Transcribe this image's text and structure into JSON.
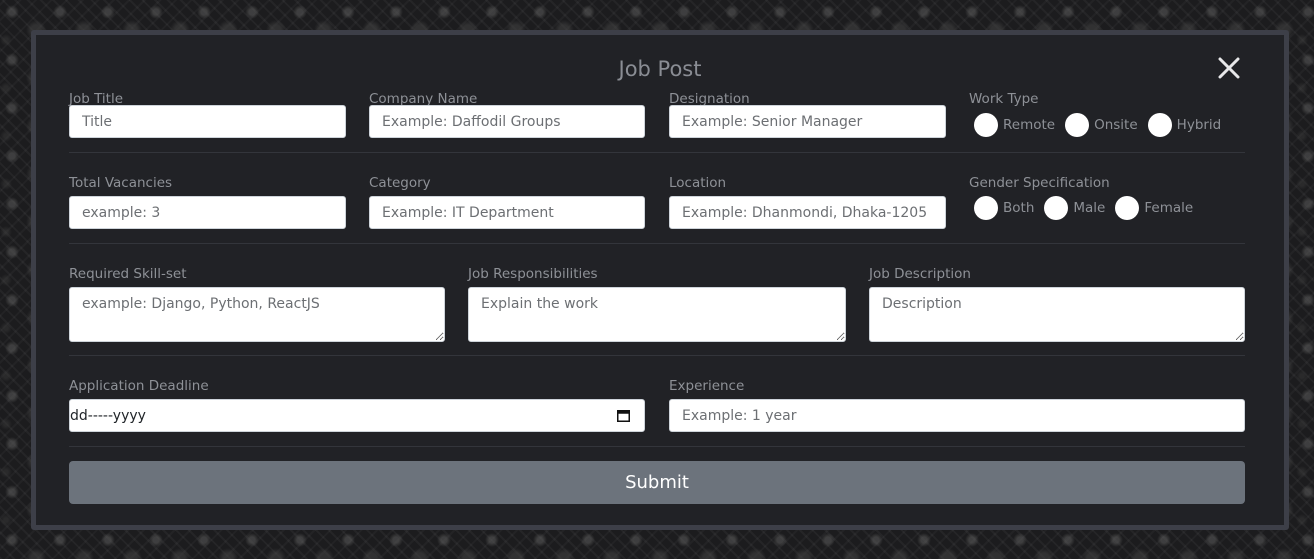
{
  "modal": {
    "title": "Job Post"
  },
  "row1": {
    "job_title": {
      "label": "Job Title",
      "placeholder": "Title"
    },
    "company_name": {
      "label": "Company Name",
      "placeholder": "Example: Daffodil Groups"
    },
    "designation": {
      "label": "Designation",
      "placeholder": "Example: Senior Manager"
    },
    "work_type": {
      "label": "Work Type",
      "options": [
        "Remote",
        "Onsite",
        "Hybrid"
      ]
    }
  },
  "row2": {
    "total_vacancies": {
      "label": "Total Vacancies",
      "placeholder": "example: 3"
    },
    "category": {
      "label": "Category",
      "placeholder": "Example: IT Department"
    },
    "location": {
      "label": "Location",
      "placeholder": "Example: Dhanmondi, Dhaka-1205"
    },
    "gender": {
      "label": "Gender Specification",
      "options": [
        "Both",
        "Male",
        "Female"
      ]
    }
  },
  "row3": {
    "skills": {
      "label": "Required Skill-set",
      "placeholder": "example: Django, Python, ReactJS"
    },
    "responsibilities": {
      "label": "Job Responsibilities",
      "placeholder": "Explain the work"
    },
    "description": {
      "label": "Job Description",
      "placeholder": "Description"
    }
  },
  "row4": {
    "deadline": {
      "label": "Application Deadline",
      "value": "dd-----yyyy"
    },
    "experience": {
      "label": "Experience",
      "placeholder": "Example: 1 year"
    }
  },
  "submit_label": "Submit",
  "icons": {
    "close": "close-icon",
    "calendar": "calendar-icon"
  },
  "colors": {
    "modal_bg": "#212226",
    "modal_border": "#3d3f48",
    "submit_bg": "#6c737c",
    "label": "#8e9197"
  }
}
